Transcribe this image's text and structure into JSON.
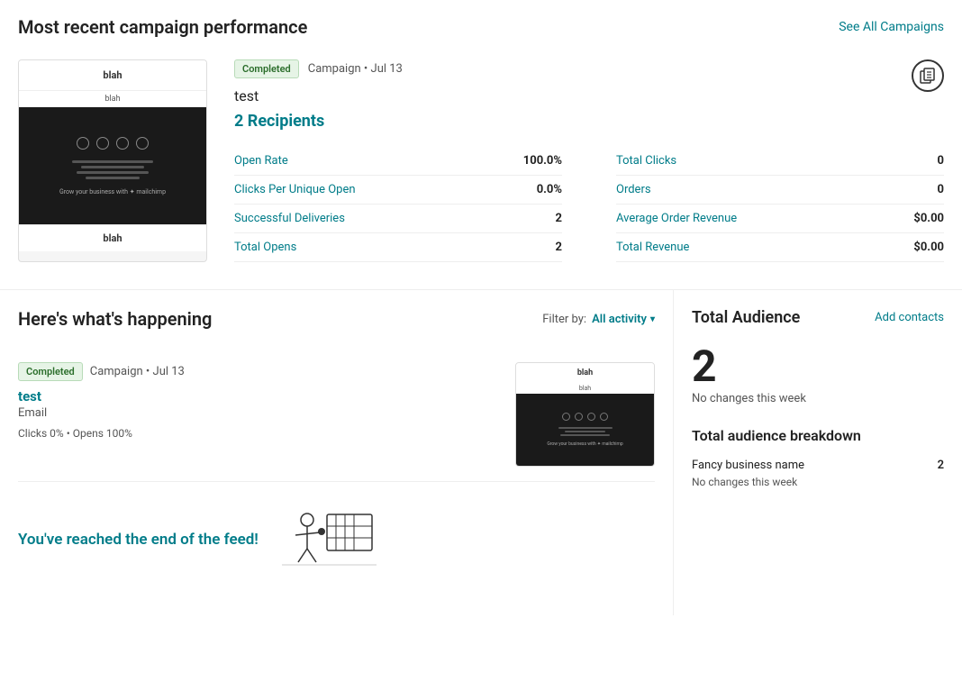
{
  "top": {
    "title": "Most recent campaign performance",
    "see_all_label": "See All Campaigns",
    "campaign": {
      "status": "Completed",
      "type_date": "Campaign • Jul 13",
      "name": "test",
      "recipients_label": "2 Recipients",
      "copy_icon": "⊞",
      "stats_left": [
        {
          "label": "Open Rate",
          "value": "100.0%"
        },
        {
          "label": "Clicks Per Unique Open",
          "value": "0.0%"
        },
        {
          "label": "Successful Deliveries",
          "value": "2"
        },
        {
          "label": "Total Opens",
          "value": "2"
        }
      ],
      "stats_right": [
        {
          "label": "Total Clicks",
          "value": "0"
        },
        {
          "label": "Orders",
          "value": "0"
        },
        {
          "label": "Average Order Revenue",
          "value": "$0.00"
        },
        {
          "label": "Total Revenue",
          "value": "$0.00"
        }
      ]
    }
  },
  "feed": {
    "title": "Here's what's happening",
    "filter_label": "Filter by:",
    "filter_value": "All activity",
    "items": [
      {
        "status": "Completed",
        "type_date": "Campaign  •  Jul 13",
        "name": "test",
        "type": "Email",
        "stats": "Clicks 0%  •  Opens 100%"
      }
    ],
    "end_text": "You've reached the end of the feed!"
  },
  "audience": {
    "title": "Total Audience",
    "add_contacts_label": "Add contacts",
    "count": "2",
    "no_changes": "No changes this week",
    "breakdown_title": "Total audience breakdown",
    "breakdown_items": [
      {
        "name": "Fancy business name",
        "count": "2",
        "sub": "No changes this week"
      }
    ]
  },
  "preview": {
    "blah_top": "blah",
    "blah_small": "blah",
    "mailchimp_text": "Grow your business with ✦ mailchimp"
  }
}
